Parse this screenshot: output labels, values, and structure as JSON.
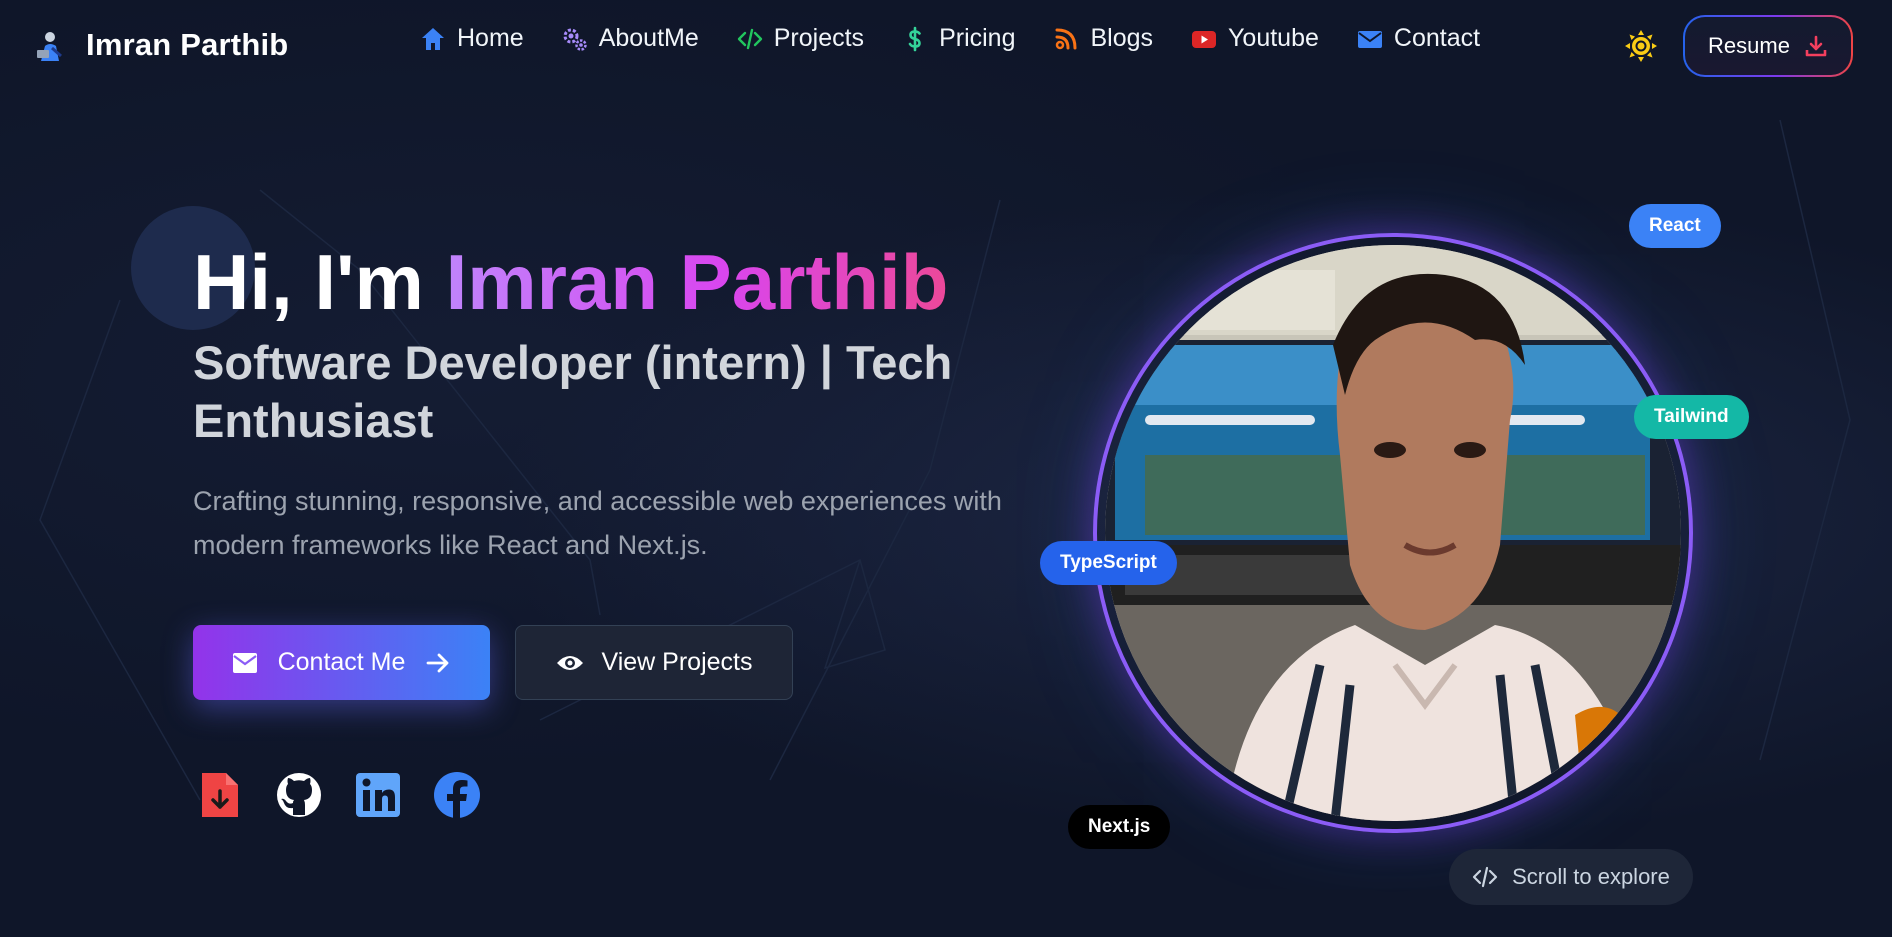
{
  "colors": {
    "background": "#0f1629",
    "accent_purple": "#9333ea",
    "accent_blue": "#3b82f6",
    "highlight_gradient": [
      "#c084fc",
      "#d946ef",
      "#ec4899"
    ]
  },
  "nav": {
    "brand_name": "Imran Parthib",
    "brand_icon": "avatar-logo-icon",
    "items": [
      {
        "label": "Home",
        "icon": "home-icon"
      },
      {
        "label": "AboutMe",
        "icon": "gears-icon"
      },
      {
        "label": "Projects",
        "icon": "code-icon"
      },
      {
        "label": "Pricing",
        "icon": "dollar-icon"
      },
      {
        "label": "Blogs",
        "icon": "blog-icon"
      },
      {
        "label": "Youtube",
        "icon": "youtube-icon"
      },
      {
        "label": "Contact",
        "icon": "envelope-icon"
      }
    ],
    "theme_toggle_icon": "sun-icon",
    "resume_label": "Resume",
    "resume_icon": "download-icon"
  },
  "hero": {
    "greeting": "Hi, I'm",
    "name": "Imran Parthib",
    "subtitle": "Software Developer (intern) | Tech Enthusiast",
    "description": "Crafting stunning, responsive, and accessible web experiences with modern frameworks like React and Next.js.",
    "primary_button": "Contact Me",
    "secondary_button": "View Projects",
    "socials": [
      {
        "name": "resume-pdf",
        "icon": "pdf-download-icon"
      },
      {
        "name": "github",
        "icon": "github-icon"
      },
      {
        "name": "linkedin",
        "icon": "linkedin-icon"
      },
      {
        "name": "facebook",
        "icon": "facebook-icon"
      }
    ]
  },
  "profile": {
    "tags": {
      "react": "React",
      "tailwind": "Tailwind",
      "typescript": "TypeScript",
      "nextjs": "Next.js"
    }
  },
  "scroll_hint": "Scroll to explore"
}
